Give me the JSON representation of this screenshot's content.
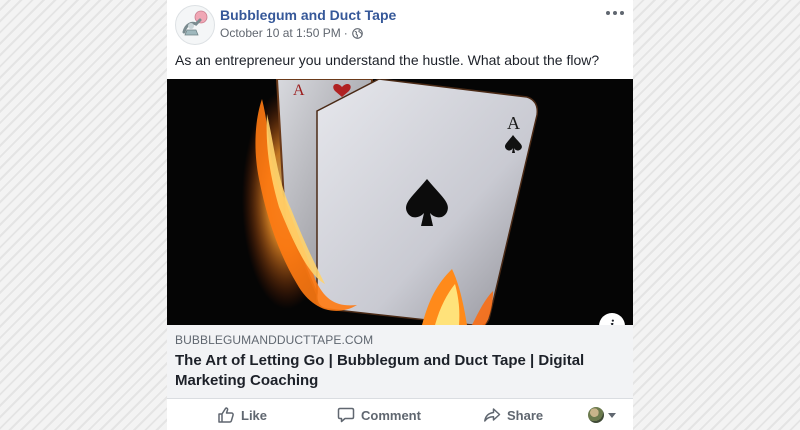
{
  "post": {
    "page_name": "Bubblegum and Duct Tape",
    "timestamp": "October 10 at 1:50 PM",
    "separator": "·",
    "privacy_icon": "globe-icon",
    "text": "As an entrepreneur you understand the hustle. What about the flow?",
    "more_icon": "more-options-icon"
  },
  "link_preview": {
    "domain": "BUBBLEGUMANDDUCTTAPE.COM",
    "title": "The Art of Letting Go | Bubblegum and Duct Tape | Digital Marketing Coaching",
    "info_label": "i"
  },
  "actions": {
    "like": "Like",
    "comment": "Comment",
    "share": "Share"
  },
  "image": {
    "card_rank_left": "A",
    "card_rank_right": "A"
  },
  "colors": {
    "page_name": "#365899",
    "meta_text": "#616770",
    "body_text": "#1d2129",
    "link_box_bg": "#f2f3f5"
  }
}
